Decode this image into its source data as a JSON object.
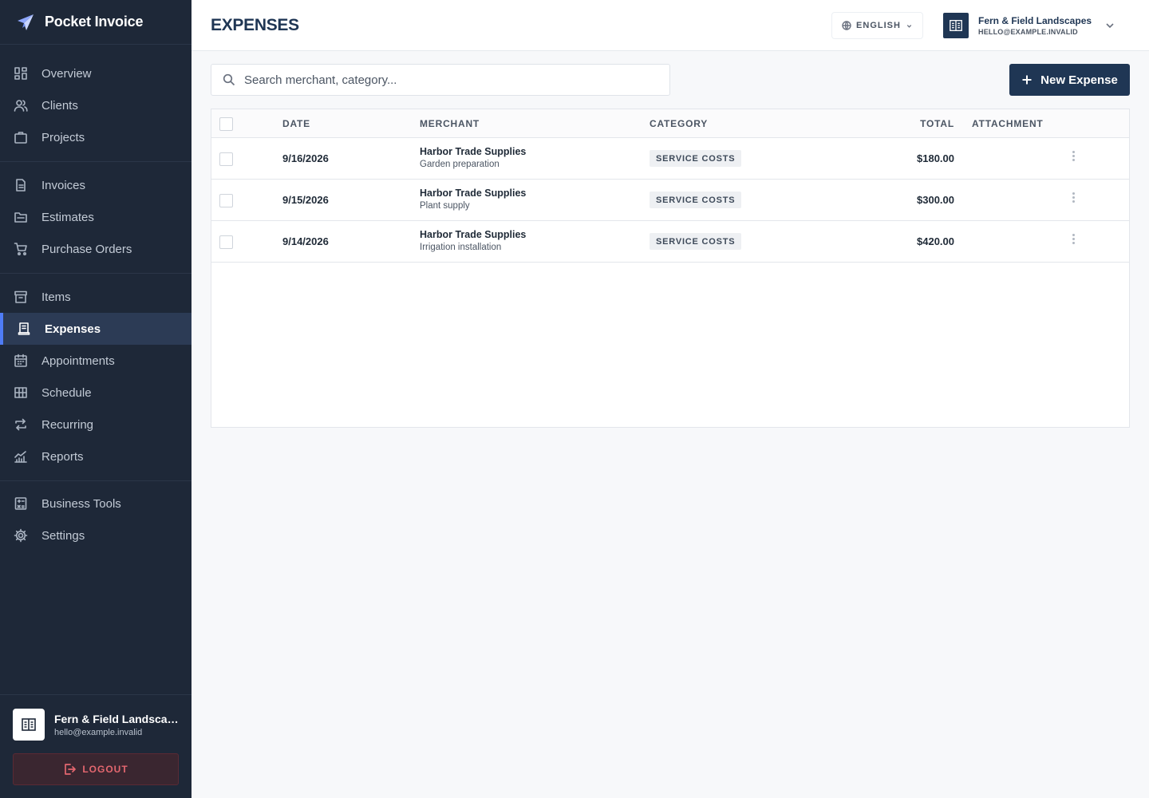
{
  "app": {
    "name": "Pocket Invoice"
  },
  "sidebar": {
    "groups": [
      [
        {
          "label": "Overview",
          "icon": "grid-icon"
        },
        {
          "label": "Clients",
          "icon": "users-icon"
        },
        {
          "label": "Projects",
          "icon": "briefcase-icon"
        }
      ],
      [
        {
          "label": "Invoices",
          "icon": "document-icon"
        },
        {
          "label": "Estimates",
          "icon": "folder-icon"
        },
        {
          "label": "Purchase Orders",
          "icon": "cart-icon"
        }
      ],
      [
        {
          "label": "Items",
          "icon": "box-icon"
        },
        {
          "label": "Expenses",
          "icon": "receipt-icon",
          "active": true
        },
        {
          "label": "Appointments",
          "icon": "calendar-icon"
        },
        {
          "label": "Schedule",
          "icon": "table-icon"
        },
        {
          "label": "Recurring",
          "icon": "repeat-icon"
        },
        {
          "label": "Reports",
          "icon": "chart-icon"
        }
      ],
      [
        {
          "label": "Business Tools",
          "icon": "calculator-icon"
        },
        {
          "label": "Settings",
          "icon": "gear-icon"
        }
      ]
    ],
    "account": {
      "name": "Fern & Field Landscapes",
      "email": "hello@example.invalid"
    },
    "logout_label": "LOGOUT"
  },
  "header": {
    "title": "EXPENSES",
    "language": "ENGLISH",
    "business": {
      "name": "Fern & Field Landscapes",
      "email": "HELLO@EXAMPLE.INVALID"
    }
  },
  "toolbar": {
    "search_placeholder": "Search merchant, category...",
    "new_label": "New Expense"
  },
  "table": {
    "columns": {
      "date": "DATE",
      "merchant": "MERCHANT",
      "category": "CATEGORY",
      "total": "TOTAL",
      "attachment": "ATTACHMENT"
    },
    "rows": [
      {
        "date": "9/16/2026",
        "merchant": "Harbor Trade Supplies",
        "description": "Garden preparation",
        "category": "SERVICE COSTS",
        "total": "$180.00"
      },
      {
        "date": "9/15/2026",
        "merchant": "Harbor Trade Supplies",
        "description": "Plant supply",
        "category": "SERVICE COSTS",
        "total": "$300.00"
      },
      {
        "date": "9/14/2026",
        "merchant": "Harbor Trade Supplies",
        "description": "Irrigation installation",
        "category": "SERVICE COSTS",
        "total": "$420.00"
      }
    ]
  },
  "colors": {
    "sidebar_bg": "#1e2838",
    "active_bg": "#2c3b55",
    "accent": "#4f7cf6",
    "primary": "#1f3654",
    "danger": "#e4676f"
  }
}
